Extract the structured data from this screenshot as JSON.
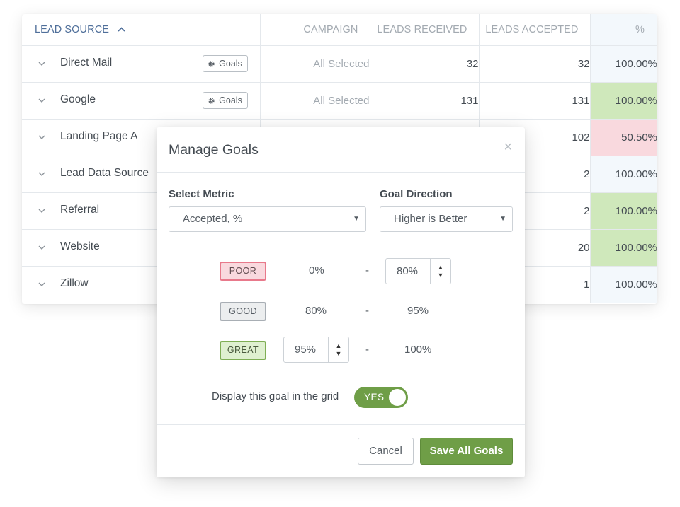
{
  "grid": {
    "columns": {
      "source": "LEAD SOURCE",
      "campaign": "CAMPAIGN",
      "received": "LEADS RECEIVED",
      "accepted": "LEADS ACCEPTED",
      "pct": "%"
    },
    "goals_button_label": "Goals",
    "rows": [
      {
        "source": "Direct Mail",
        "campaign": "All Selected",
        "received": "32",
        "accepted": "32",
        "pct": "100.00%",
        "status": "neutral"
      },
      {
        "source": "Google",
        "campaign": "All Selected",
        "received": "131",
        "accepted": "131",
        "pct": "100.00%",
        "status": "good"
      },
      {
        "source": "Landing Page A",
        "campaign": "",
        "received": "",
        "accepted": "102",
        "pct": "50.50%",
        "status": "poor"
      },
      {
        "source": "Lead Data Source",
        "campaign": "",
        "received": "",
        "accepted": "2",
        "pct": "100.00%",
        "status": "neutral"
      },
      {
        "source": "Referral",
        "campaign": "",
        "received": "",
        "accepted": "2",
        "pct": "100.00%",
        "status": "good"
      },
      {
        "source": "Website",
        "campaign": "",
        "received": "",
        "accepted": "20",
        "pct": "100.00%",
        "status": "good"
      },
      {
        "source": "Zillow",
        "campaign": "",
        "received": "",
        "accepted": "1",
        "pct": "100.00%",
        "status": "neutral"
      }
    ]
  },
  "modal": {
    "title": "Manage Goals",
    "close_glyph": "×",
    "metric_label": "Select Metric",
    "metric_value": "Accepted, %",
    "direction_label": "Goal Direction",
    "direction_value": "Higher is Better",
    "dash": "-",
    "poor": {
      "label": "POOR",
      "from": "0%",
      "to": "80%"
    },
    "good": {
      "label": "GOOD",
      "from": "80%",
      "to": "95%"
    },
    "great": {
      "label": "GREAT",
      "from": "95%",
      "to": "100%"
    },
    "display_label": "Display this goal in the grid",
    "toggle_text": "YES",
    "cancel_label": "Cancel",
    "save_label": "Save All Goals"
  },
  "colors": {
    "accent_green": "#6f9e47",
    "good_fill": "#cfe8bb",
    "poor_fill": "#f9d9de",
    "header_blue": "#4f6f9a"
  }
}
